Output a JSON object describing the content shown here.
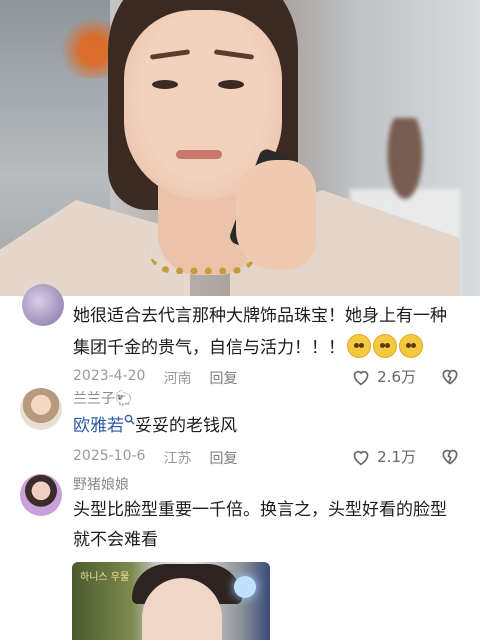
{
  "comments": [
    {
      "text_line1": "她很适合去代言那种大牌饰品珠宝！她身上有一种",
      "text_line2": "集团千金的贵气，自信与活力！！！",
      "date": "2023-4-20",
      "location": "河南",
      "reply_label": "回复",
      "likes": "2.6万"
    },
    {
      "username": "兰兰子🐑",
      "mention": "欧雅若",
      "text": "妥妥的老钱风",
      "date": "2025-10-6",
      "location": "江苏",
      "reply_label": "回复",
      "likes": "2.1万"
    },
    {
      "username": "野猪娘娘",
      "text_line1": "头型比脸型重要一千倍。换言之，头型好看的脸型",
      "text_line2": "就不会难看",
      "image_logo": "하니스 우물"
    }
  ],
  "icons": {
    "like": "heart-outline-icon",
    "dislike": "broken-heart-icon",
    "emoji": "pleading-face-emoji",
    "mention": "search-icon"
  },
  "colors": {
    "text": "#1c1c1c",
    "meta": "#9a9a9a",
    "mention": "#2d5aa8"
  }
}
